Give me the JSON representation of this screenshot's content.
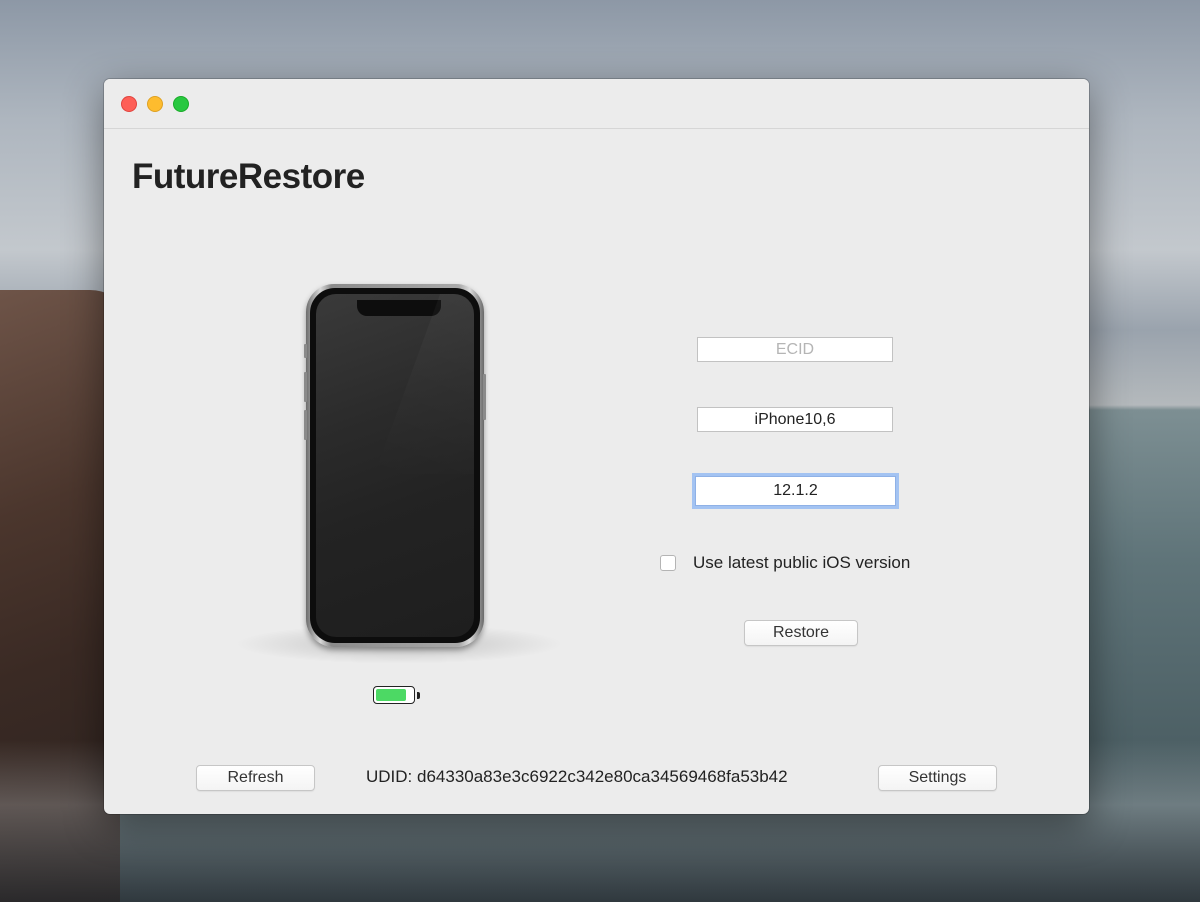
{
  "window": {
    "app_title": "FutureRestore"
  },
  "form": {
    "ecid_placeholder": "ECID",
    "ecid_value": "",
    "device_value": "iPhone10,6",
    "ios_version_value": "12.1.2",
    "latest_checkbox_label": "Use latest public iOS version",
    "latest_checked": false,
    "restore_label": "Restore"
  },
  "device": {
    "battery_level": 0.85,
    "battery_color": "#4cd964"
  },
  "footer": {
    "refresh_label": "Refresh",
    "udid_text": "UDID: d64330a83e3c6922c342e80ca34569468fa53b42",
    "settings_label": "Settings"
  },
  "colors": {
    "close": "#fe5f57",
    "minimize": "#febc2e",
    "maximize": "#28c840",
    "focus_ring": "#a3c3f2"
  }
}
